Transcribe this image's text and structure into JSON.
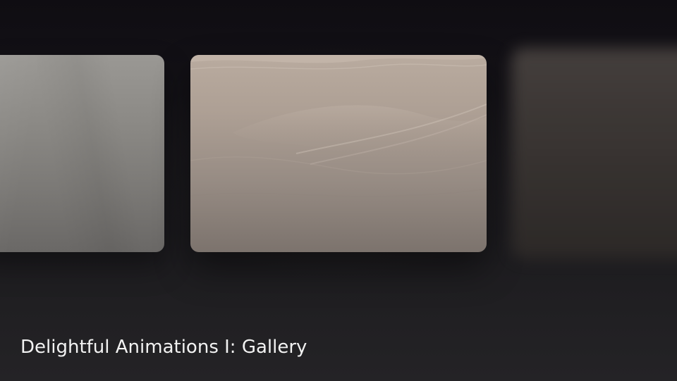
{
  "video": {
    "title": "Delightful Animations I: Gallery"
  },
  "gallery": {
    "cards": [
      {
        "id": "left",
        "state": "partially-visible"
      },
      {
        "id": "center",
        "state": "focused"
      },
      {
        "id": "right",
        "state": "blurred"
      }
    ]
  },
  "colors": {
    "background": "#17161a",
    "title_text": "#f2f2f2",
    "center_card_top": "#b9ab9f",
    "left_card_top": "#9a9894"
  }
}
